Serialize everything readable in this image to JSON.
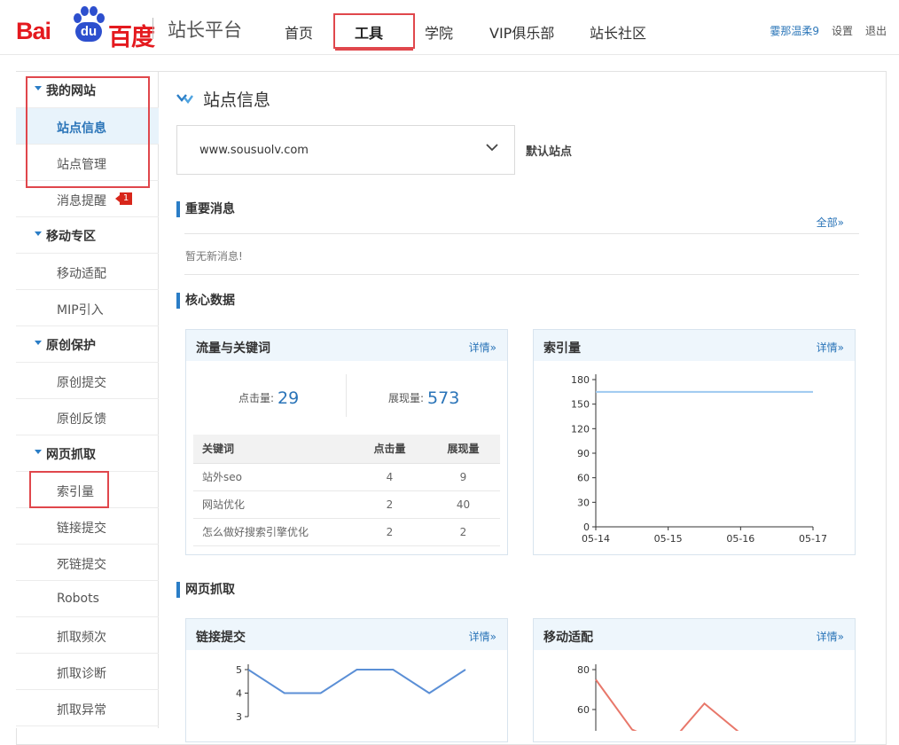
{
  "header": {
    "logo_left": "Bai",
    "logo_du": "du",
    "logo_right": "百度",
    "platform": "站长平台",
    "nav": [
      {
        "label": "首页"
      },
      {
        "label": "工具"
      },
      {
        "label": "学院"
      },
      {
        "label": "VIP俱乐部"
      },
      {
        "label": "站长社区"
      }
    ],
    "active_nav": "工具",
    "user_name": "霎那温柔9",
    "settings": "设置",
    "logout": "退出"
  },
  "sidebar": {
    "groups": [
      {
        "label": "我的网站",
        "items": [
          {
            "label": "站点信息"
          },
          {
            "label": "站点管理"
          },
          {
            "label": "消息提醒",
            "badge": "1"
          }
        ]
      },
      {
        "label": "移动专区",
        "items": [
          {
            "label": "移动适配"
          },
          {
            "label": "MIP引入"
          }
        ]
      },
      {
        "label": "原创保护",
        "items": [
          {
            "label": "原创提交"
          },
          {
            "label": "原创反馈"
          }
        ]
      },
      {
        "label": "网页抓取",
        "items": [
          {
            "label": "索引量"
          },
          {
            "label": "链接提交"
          },
          {
            "label": "死链提交"
          },
          {
            "label": "Robots"
          },
          {
            "label": "抓取频次"
          },
          {
            "label": "抓取诊断"
          },
          {
            "label": "抓取异常"
          }
        ]
      }
    ],
    "selected_item": "站点信息"
  },
  "main": {
    "page_title": "站点信息",
    "site_select_value": "www.sousuolv.com",
    "default_site": "默认站点",
    "important_msg": {
      "title": "重要消息",
      "more": "全部»",
      "empty": "暂无新消息!"
    },
    "core_title": "核心数据",
    "crawl_title": "网页抓取",
    "traffic": {
      "title": "流量与关键词",
      "link": "详情»",
      "clicks_label": "点击量:",
      "clicks": "29",
      "impressions_label": "展现量:",
      "impressions": "573",
      "columns": [
        "关键词",
        "点击量",
        "展现量"
      ],
      "rows": [
        [
          "站外seo",
          "4",
          "9"
        ],
        [
          "网站优化",
          "2",
          "40"
        ],
        [
          "怎么做好搜索引擎优化",
          "2",
          "2"
        ]
      ]
    },
    "index_card": {
      "title": "索引量",
      "link": "详情»"
    },
    "link_submit_card": {
      "title": "链接提交",
      "link": "详情»"
    },
    "mobile_card": {
      "title": "移动适配",
      "link": "详情»"
    }
  },
  "colors": {
    "brand_red": "#e41a1f",
    "brand_blue": "#2d4fce",
    "link_blue": "#2a74b8",
    "highlight": "#e0474c"
  },
  "chart_data": [
    {
      "type": "line",
      "x": [
        "05-14",
        "05-15",
        "05-16",
        "05-17"
      ],
      "series": [
        {
          "values": [
            165,
            165,
            165,
            165
          ]
        }
      ],
      "ylim": [
        0,
        180
      ],
      "yticks": [
        0,
        30,
        60,
        90,
        120,
        150,
        180
      ]
    },
    {
      "type": "line",
      "x": [
        1,
        2,
        3,
        4,
        5,
        6,
        7
      ],
      "series": [
        {
          "values": [
            5,
            4,
            4,
            5,
            5,
            4,
            5
          ]
        }
      ],
      "ylim": [
        3,
        5
      ],
      "yticks": [
        3,
        4,
        5
      ]
    },
    {
      "type": "line",
      "x": [
        1,
        2,
        3,
        4,
        5,
        6,
        7
      ],
      "series": [
        {
          "values": [
            75,
            50,
            42,
            63,
            48,
            48,
            45
          ]
        }
      ],
      "ylim": [
        40,
        80
      ],
      "yticks": [
        60,
        80
      ]
    }
  ]
}
